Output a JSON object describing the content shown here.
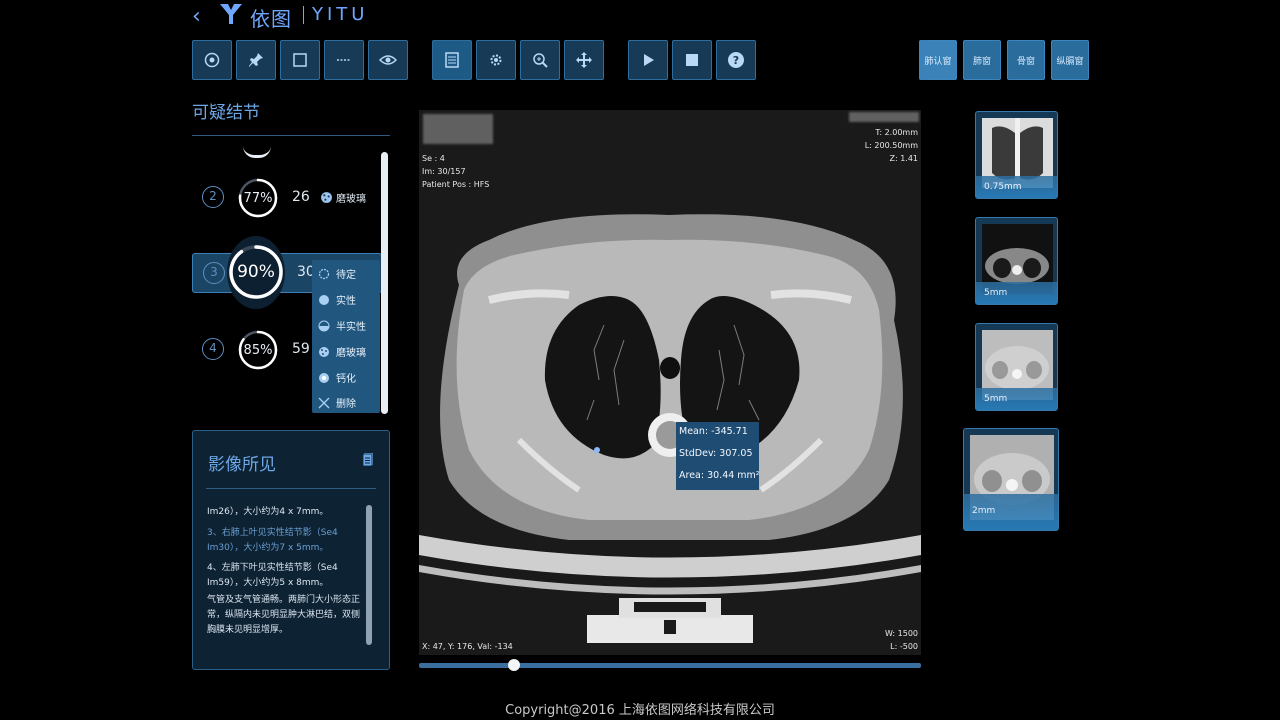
{
  "brand": {
    "name_cn": "依图",
    "name_en": "YITU"
  },
  "toolbar": {
    "tools": [
      "target-icon",
      "pin-icon",
      "rect-icon",
      "ruler-icon",
      "eye-icon",
      "layout-icon",
      "settings-icon",
      "zoom-icon",
      "pan-icon",
      "play-icon",
      "stop-icon",
      "help-icon"
    ],
    "view_tabs": [
      "肺认窗",
      "肺窗",
      "骨窗",
      "纵膈窗"
    ]
  },
  "nodules": {
    "title": "可疑结节",
    "items": [
      {
        "index": "2",
        "percent": "77%",
        "value": 77,
        "size": "26",
        "type": "磨玻璃"
      },
      {
        "index": "3",
        "percent": "90%",
        "value": 90,
        "size": "30"
      },
      {
        "index": "4",
        "percent": "85%",
        "value": 85,
        "size": "59"
      }
    ],
    "menu": [
      "待定",
      "实性",
      "半实性",
      "磨玻璃",
      "钙化",
      "删除"
    ]
  },
  "findings": {
    "title": "影像所见",
    "lines": [
      "Im26），大小约为4 x 7mm。",
      "3、右肺上叶见实性结节影（Se4 Im30），大小约为7 x 5mm。",
      "4、左肺下叶见实性结节影（Se4 Im59），大小约为5 x 8mm。",
      "气管及支气管通畅。两肺门大小形态正常，纵隔内未见明显肿大淋巴结，双侧胸膜未见明显增厚。"
    ]
  },
  "viewer": {
    "info_left": [
      "Se : 4",
      "Im: 30/157",
      "Patient Pos : HFS"
    ],
    "info_right": [
      "T: 2.00mm",
      "L: 200.50mm",
      "Z: 1.41"
    ],
    "coords": "X: 47, Y: 176, Val: -134",
    "wl": [
      "W: 1500",
      "L: -500"
    ],
    "measure": {
      "mean": "Mean: -345.71",
      "stddev": "StdDev: 307.05",
      "area": "Area: 30.44 mm²"
    },
    "slice_position": 0.19
  },
  "thumbnails": [
    "0.75mm",
    "5mm",
    "5mm",
    "2mm"
  ],
  "copyright": "Copyright@2016 上海依图网络科技有限公司",
  "colors": {
    "accent": "#3a82b8",
    "panel": "#0d2233",
    "background": "#000000"
  }
}
